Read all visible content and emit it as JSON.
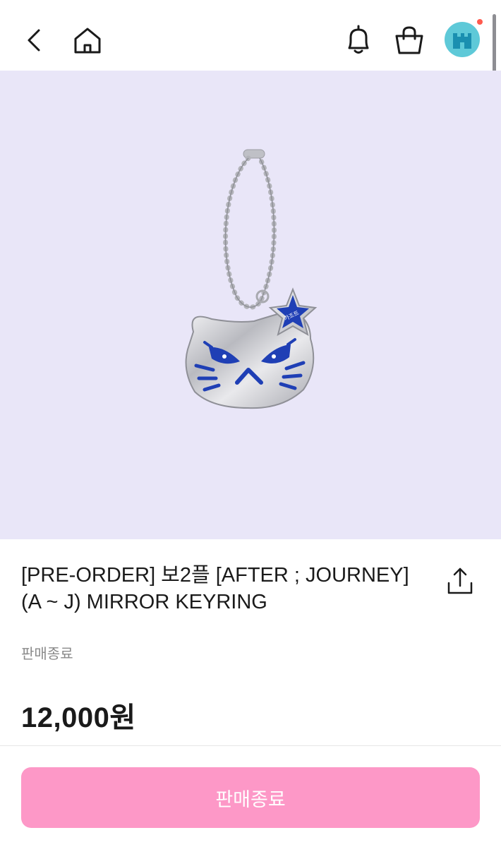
{
  "header": {
    "back_icon": "chevron-left-icon",
    "home_icon": "home-icon",
    "bell_icon": "bell-icon",
    "cart_icon": "shopping-bag-icon",
    "has_notification": true,
    "avatar_color": "#5ec9d8"
  },
  "hero": {
    "background_color": "#e9e6f8",
    "star_text": "가조트"
  },
  "product": {
    "title": "[PRE-ORDER] 보2플 [AFTER ; JOURNEY] (A ~ J) MIRROR KEYRING",
    "sale_status": "판매종료",
    "price": "12,000원",
    "share_icon": "share-icon"
  },
  "footer": {
    "cta_label": "판매종료",
    "cta_color": "#fd98c7"
  }
}
